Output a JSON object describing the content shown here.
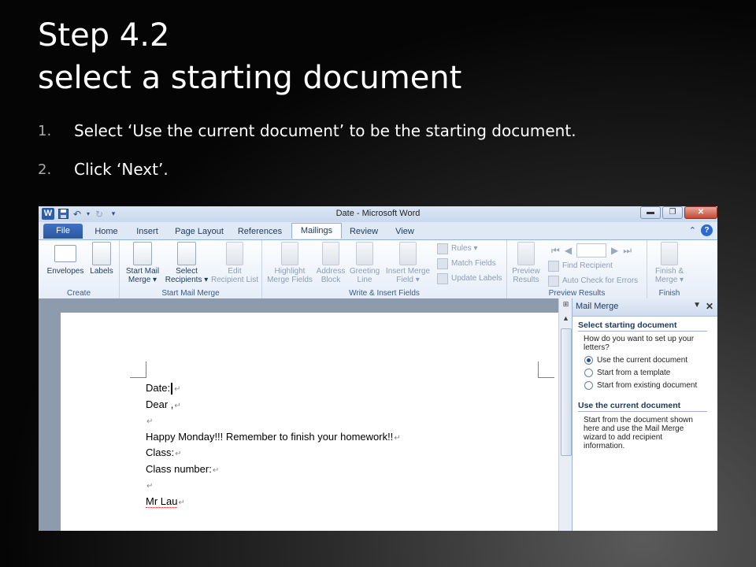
{
  "slide": {
    "title_line1": "Step 4.2",
    "title_line2": "select a starting document",
    "steps": [
      {
        "num": "1.",
        "text": "Select ‘Use the current document’ to be the starting document."
      },
      {
        "num": "2.",
        "text": "Click ‘Next’."
      }
    ]
  },
  "word": {
    "window_title": "Date  -  Microsoft Word",
    "qat_icons": [
      "word-logo-icon",
      "save-icon",
      "undo-icon",
      "redo-icon",
      "customize-qat-icon"
    ],
    "tabs": [
      "File",
      "Home",
      "Insert",
      "Page Layout",
      "References",
      "Mailings",
      "Review",
      "View"
    ],
    "active_tab": "Mailings",
    "ribbon": {
      "groups": {
        "create": "Create",
        "start_mail_merge": "Start Mail Merge",
        "write_insert": "Write & Insert Fields",
        "preview_results": "Preview Results",
        "finish": "Finish"
      },
      "envelopes": "Envelopes",
      "labels": "Labels",
      "start_mail_merge_1": "Start Mail",
      "start_mail_merge_2": "Merge ▾",
      "select_recipients_1": "Select",
      "select_recipients_2": "Recipients ▾",
      "edit_list_1": "Edit",
      "edit_list_2": "Recipient List",
      "highlight_1": "Highlight",
      "highlight_2": "Merge Fields",
      "address_1": "Address",
      "address_2": "Block",
      "greeting_1": "Greeting",
      "greeting_2": "Line",
      "insert_field_1": "Insert Merge",
      "insert_field_2": "Field ▾",
      "rules": "Rules ▾",
      "match_fields": "Match Fields",
      "update_labels": "Update Labels",
      "preview_1": "Preview",
      "preview_2": "Results",
      "find_recipient": "Find Recipient",
      "auto_check": "Auto Check for Errors",
      "finish_1": "Finish &",
      "finish_2": "Merge ▾"
    },
    "document_lines": [
      "Date:",
      "Dear ,",
      "",
      "Happy Monday!!! Remember to finish your homework!!",
      "Class:",
      "Class number:",
      "",
      "Mr Lau"
    ],
    "paragraph_mark": "↵",
    "mail_merge_pane": {
      "title": "Mail Merge",
      "section1": "Select starting document",
      "question": "How do you want to set up your letters?",
      "options": [
        "Use the current document",
        "Start from a template",
        "Start from existing document"
      ],
      "selected_index": 0,
      "section2": "Use the current document",
      "description": "Start from the document shown here and use the Mail Merge wizard to add recipient information."
    }
  }
}
